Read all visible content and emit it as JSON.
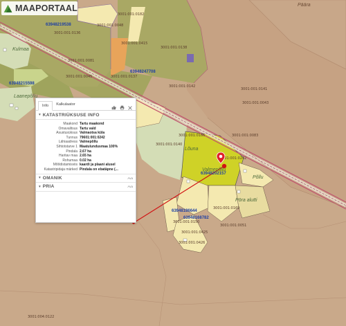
{
  "logo": {
    "text": "MAAPORTAAL"
  },
  "map": {
    "parcel_labels": [
      "3001:001:0182",
      "3001:001:0048",
      "3001:001:0136",
      "3001:001:0081",
      "3001:001:0415",
      "3001:001:0138",
      "3001:001:0137",
      "3001:001:0142",
      "3001:001:0141",
      "3001:001:0140",
      "3001:001:0045",
      "3001:001:0166",
      "3001:001:0083",
      "3001:001:0242",
      "3001:001:0150",
      "3001:001:0169",
      "3001:001:0051",
      "3001:001:0425",
      "3001:001:0426",
      "3001:004:0122",
      "3001:001:0043"
    ],
    "cadastral_codes": [
      "63948219538",
      "63948215598",
      "63948247708",
      "63948186644",
      "63948168782",
      "63948202157"
    ],
    "place_names": [
      "Kulmaa",
      "Laanepõllu",
      "Lõuna",
      "Valmepõllu",
      "Päära",
      "Põllu",
      "Pöra alutti"
    ]
  },
  "panel": {
    "tabs": [
      "Info",
      "Kalkulaator"
    ],
    "section_title": "KATASTRIÜKSUSE INFO",
    "rows": [
      {
        "label": "Maakond",
        "value": "Tartu maakond"
      },
      {
        "label": "Omavalitsus",
        "value": "Tartu vald"
      },
      {
        "label": "Asustusüksus",
        "value": "Valmaotsa küla"
      },
      {
        "label": "Tunnus",
        "value": "79601:001:0242"
      },
      {
        "label": "Lähiaadress",
        "value": "Valmepõllu"
      },
      {
        "label": "Sihtotstarve 1",
        "value": "Maatulundusmaa 100%"
      },
      {
        "label": "Pindala",
        "value": "2.67 ha"
      },
      {
        "label": "Haritav maa",
        "value": "2.65 ha"
      },
      {
        "label": "Rohumaa",
        "value": "0.02 ha"
      },
      {
        "label": "Mõõdistamisviis",
        "value": "kaardi ja plaani alusel"
      },
      {
        "label": "Katastripidaja märked",
        "value": "Pindala on ebatäpne (..."
      }
    ],
    "owner_section": "OMANIK",
    "prior_section": "PRIA",
    "expand_label": "Ava"
  },
  "colors": {
    "map_background": "#c9a98a",
    "agricultural": "#a9a864",
    "selected_parcel": "#cfd227",
    "residential": "#f4e9b0",
    "forest": "#d4ddb6",
    "road": "#c05070",
    "leader_line": "#d11313",
    "marker": "#e0202a"
  }
}
